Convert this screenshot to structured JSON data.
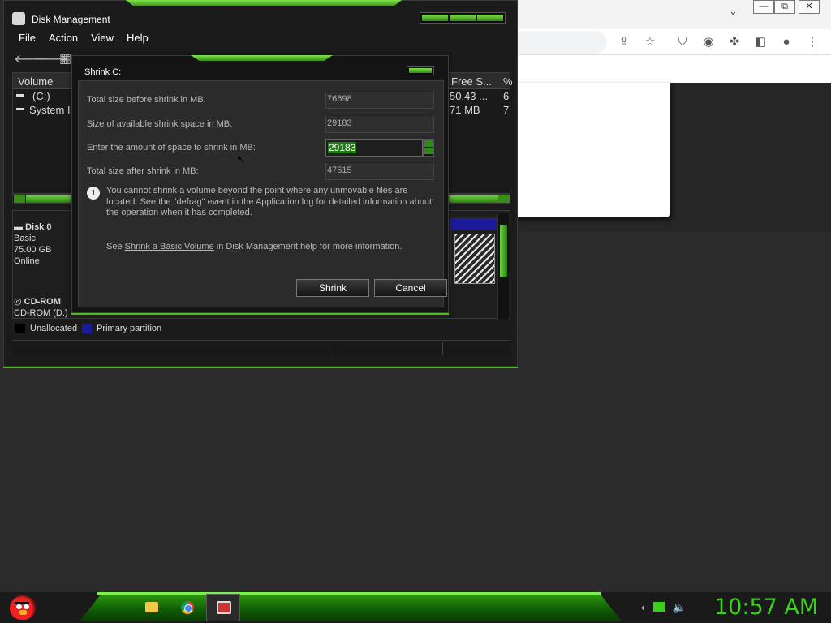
{
  "browser": {
    "min_label": "—",
    "restore_label": "⧉",
    "close_label": "✕",
    "chevron": "⌄",
    "toolbar_icons": [
      "share-icon",
      "star-icon",
      "shield-icon",
      "flag-icon",
      "puzzle-icon",
      "sidepanel-icon",
      "profile-icon",
      "menu-icon"
    ]
  },
  "disk_management": {
    "title": "Disk Management",
    "menu": [
      "File",
      "Action",
      "View",
      "Help"
    ],
    "volume_columns": {
      "volume": "Volume",
      "free_space": "Free S...",
      "percent": "%"
    },
    "volumes": [
      {
        "name": "(C:)",
        "free": "50.43 ...",
        "pct": "6"
      },
      {
        "name": "System I",
        "free": "71 MB",
        "pct": "7"
      }
    ],
    "disks": [
      {
        "name": "Disk 0",
        "type": "Basic",
        "size": "75.00 GB",
        "status": "Online"
      },
      {
        "name": "CD-ROM",
        "drive": "CD-ROM (D:)"
      }
    ],
    "legend": [
      {
        "label": "Unallocated",
        "color": "#000000"
      },
      {
        "label": "Primary partition",
        "color": "#1b1a99"
      }
    ]
  },
  "dialog": {
    "title": "Shrink C:",
    "fields": [
      {
        "label": "Total size before shrink in MB:",
        "value": "76698"
      },
      {
        "label": "Size of available shrink space in MB:",
        "value": "29183"
      },
      {
        "label": "Enter the amount of space to shrink in MB:",
        "value": "29183"
      },
      {
        "label": "Total size after shrink in MB:",
        "value": "47515"
      }
    ],
    "info": "You cannot shrink a volume beyond the point where any unmovable files are located. See the \"defrag\" event in the Application log for detailed information about the operation when it has completed.",
    "see_prefix": "See ",
    "see_link": "Shrink a Basic Volume",
    "see_suffix": " in Disk Management help for more information.",
    "shrink_label": "Shrink",
    "cancel_label": "Cancel"
  },
  "taskbar": {
    "clock": "10:57 AM",
    "apps": [
      "file-explorer",
      "chrome",
      "disk-management"
    ]
  },
  "colors": {
    "accent_green": "#3ad11a",
    "partition_blue": "#1b1a99"
  }
}
